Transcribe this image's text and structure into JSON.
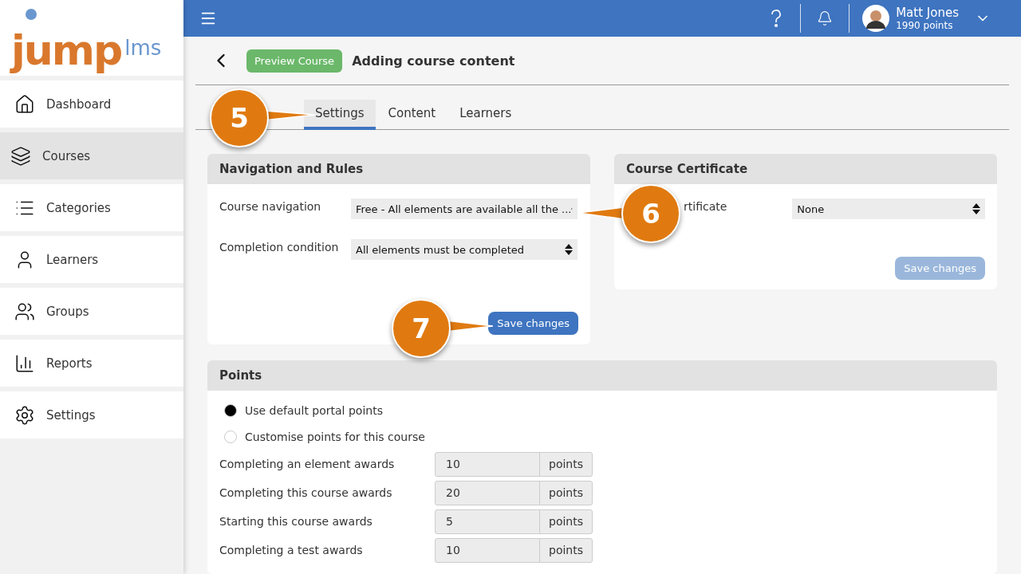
{
  "logo": {
    "main": "jump",
    "suffix": "lms"
  },
  "sidebar": {
    "items": [
      {
        "label": "Dashboard",
        "selected": false
      },
      {
        "label": "Courses",
        "selected": true
      },
      {
        "label": "Categories",
        "selected": false
      },
      {
        "label": "Learners",
        "selected": false
      },
      {
        "label": "Groups",
        "selected": false
      },
      {
        "label": "Reports",
        "selected": false
      },
      {
        "label": "Settings",
        "selected": false
      }
    ]
  },
  "topbar": {
    "user": {
      "name": "Matt Jones",
      "points": "1990 points"
    }
  },
  "header": {
    "preview_button": "Preview Course",
    "title": "Adding course content"
  },
  "tabs": [
    {
      "label": "Settings",
      "selected": true
    },
    {
      "label": "Content",
      "selected": false
    },
    {
      "label": "Learners",
      "selected": false
    }
  ],
  "navigation_card": {
    "title": "Navigation and Rules",
    "fields": [
      {
        "label": "Course navigation",
        "value": "Free - All elements are available all the ..."
      },
      {
        "label": "Completion condition",
        "value": "All elements must be completed"
      }
    ],
    "save_button": {
      "label": "Save changes",
      "disabled": false
    }
  },
  "certificate_card": {
    "title": "Course Certificate",
    "fields": [
      {
        "label": "rtificate",
        "value": "None"
      }
    ],
    "save_button": {
      "label": "Save changes",
      "disabled": true
    }
  },
  "points_card": {
    "title": "Points",
    "options": [
      {
        "label": "Use default portal points",
        "selected": true
      },
      {
        "label": "Customise points for this course",
        "selected": false
      }
    ],
    "rows": [
      {
        "label": "Completing an element awards",
        "value": "10",
        "unit": "points"
      },
      {
        "label": "Completing this course awards",
        "value": "20",
        "unit": "points"
      },
      {
        "label": "Starting this course awards",
        "value": "5",
        "unit": "points"
      },
      {
        "label": "Completing a test awards",
        "value": "10",
        "unit": "points"
      }
    ]
  },
  "callouts": [
    {
      "number": "5"
    },
    {
      "number": "6"
    },
    {
      "number": "7"
    }
  ]
}
